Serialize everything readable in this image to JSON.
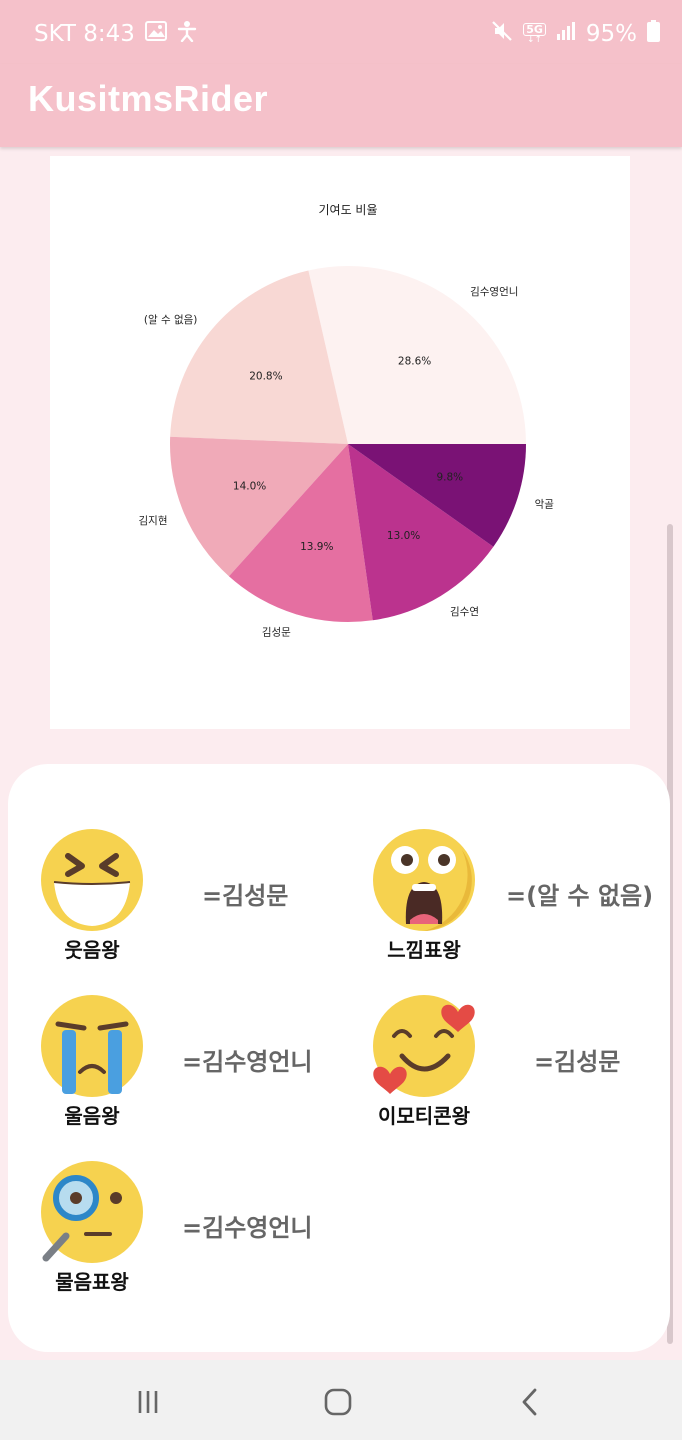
{
  "status_bar": {
    "carrier_time": "SKT 8:43",
    "network": "5G",
    "battery": "95%",
    "icons": [
      "gallery-icon",
      "accessibility-icon",
      "mute-icon",
      "network-5g-icon",
      "signal-icon",
      "battery-icon"
    ]
  },
  "app_bar": {
    "title": "KusitmsRider"
  },
  "chart_data": {
    "type": "pie",
    "title": "기여도 비율",
    "slices": [
      {
        "label": "김수영언니",
        "value": 28.6,
        "pct_label": "28.6%",
        "color": "#fdf2f1"
      },
      {
        "label": "(알 수 없음)",
        "value": 20.8,
        "pct_label": "20.8%",
        "color": "#f8d8d4"
      },
      {
        "label": "김지현",
        "value": 14.0,
        "pct_label": "14.0%",
        "color": "#f0aab8"
      },
      {
        "label": "김성문",
        "value": 13.9,
        "pct_label": "13.9%",
        "color": "#e56fa1"
      },
      {
        "label": "김수연",
        "value": 13.0,
        "pct_label": "13.0%",
        "color": "#bb338e"
      },
      {
        "label": "악골",
        "value": 9.8,
        "pct_label": "9.8%",
        "color": "#7a1275"
      }
    ]
  },
  "awards": [
    {
      "icon": "laughing-face-icon",
      "label": "웃음왕",
      "winner": "=김성문"
    },
    {
      "icon": "shocked-face-icon",
      "label": "느낌표왕",
      "winner": "=(알 수 없음)"
    },
    {
      "icon": "crying-face-icon",
      "label": "울음왕",
      "winner": "=김수영언니"
    },
    {
      "icon": "hearts-face-icon",
      "label": "이모티콘왕",
      "winner": "=김성문"
    },
    {
      "icon": "magnifier-face-icon",
      "label": "물음표왕",
      "winner": "=김수영언니"
    }
  ],
  "nav_bar": {
    "buttons": [
      "recent-apps-icon",
      "home-icon",
      "back-icon"
    ]
  },
  "colors": {
    "primary": "#f5c1ca",
    "background": "#fcecef",
    "emoji_yellow": "#f6d24f"
  }
}
